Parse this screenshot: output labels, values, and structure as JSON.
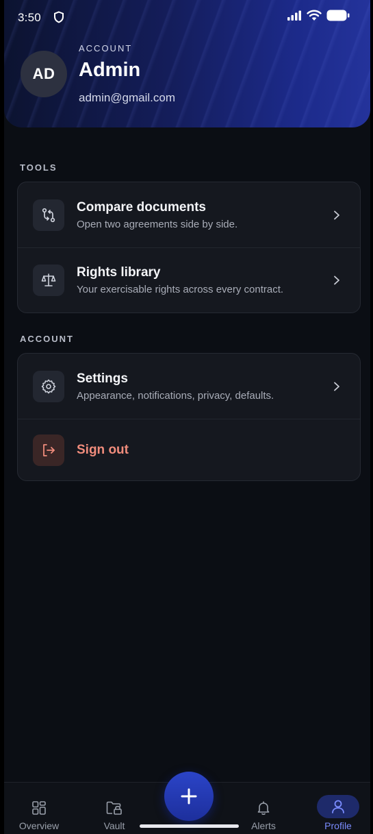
{
  "status_bar": {
    "time": "3:50"
  },
  "header": {
    "eyebrow": "ACCOUNT",
    "avatar_initials": "AD",
    "name": "Admin",
    "email": "admin@gmail.com"
  },
  "sections": {
    "tools": {
      "label": "TOOLS",
      "items": [
        {
          "title": "Compare documents",
          "subtitle": "Open two agreements side by side.",
          "icon": "compare-arrows-icon"
        },
        {
          "title": "Rights library",
          "subtitle": "Your exercisable rights across every contract.",
          "icon": "scales-icon"
        }
      ]
    },
    "account": {
      "label": "ACCOUNT",
      "items": [
        {
          "title": "Settings",
          "subtitle": "Appearance, notifications, privacy, defaults.",
          "icon": "gear-icon"
        },
        {
          "title": "Sign out",
          "icon": "sign-out-icon"
        }
      ]
    }
  },
  "tabbar": {
    "tabs": [
      {
        "label": "Overview",
        "icon": "grid-icon"
      },
      {
        "label": "Vault",
        "icon": "folder-lock-icon"
      },
      {
        "label": "Alerts",
        "icon": "bell-icon"
      },
      {
        "label": "Profile",
        "icon": "person-icon",
        "active": true
      }
    ],
    "fab_icon": "plus-icon"
  },
  "colors": {
    "background": "#0b0e14",
    "card": "#15181f",
    "accent": "#7a8cff",
    "danger": "#f08c7c",
    "header_gradient_end": "#24339b"
  }
}
